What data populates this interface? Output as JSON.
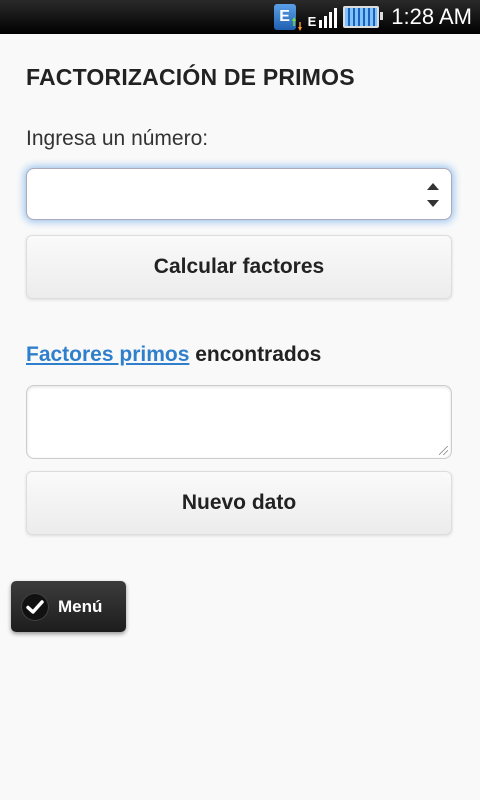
{
  "status_bar": {
    "network_badge": "E",
    "signal_label": "E",
    "time": "1:28 AM",
    "icons": [
      "network-type-icon",
      "signal-icon",
      "battery-icon"
    ]
  },
  "app": {
    "title": "FACTORIZACIÓN DE PRIMOS",
    "prompt_label": "Ingresa un número:",
    "number_input": {
      "value": "",
      "placeholder": ""
    },
    "calculate_button": "Calcular factores",
    "result_heading_link": "Factores primos",
    "result_heading_rest": " encontrados",
    "result_value": "",
    "new_data_button": "Nuevo dato",
    "menu_button": "Menú"
  },
  "colors": {
    "link": "#2f7fcc",
    "focus_glow": "#9cc4ee",
    "background": "#f9f9f9"
  }
}
